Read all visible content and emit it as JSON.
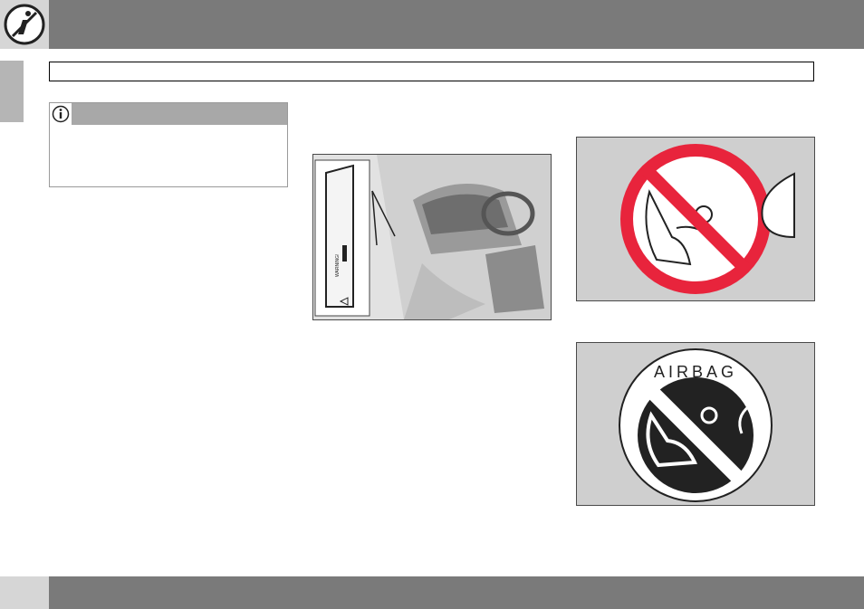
{
  "header": {
    "chapter_icon": "seatbelt-info-icon"
  },
  "section_title": "",
  "note": {
    "icon": "info-icon",
    "title": "",
    "text": ""
  },
  "figures": {
    "car_interior": {
      "label_text": "WARNING!"
    },
    "no_child_seat": {
      "icon": "no-rear-facing-child-seat-icon",
      "color": "#e8243c"
    },
    "airbag": {
      "label": "AIRBAG",
      "icon": "airbag-child-seat-warning-icon"
    }
  },
  "footer": {
    "page_number": ""
  },
  "colors": {
    "bar": "#7a7a7a",
    "tab": "#b5b5b5",
    "note_header": "#a8a8a8",
    "warning_red": "#e8243c"
  }
}
